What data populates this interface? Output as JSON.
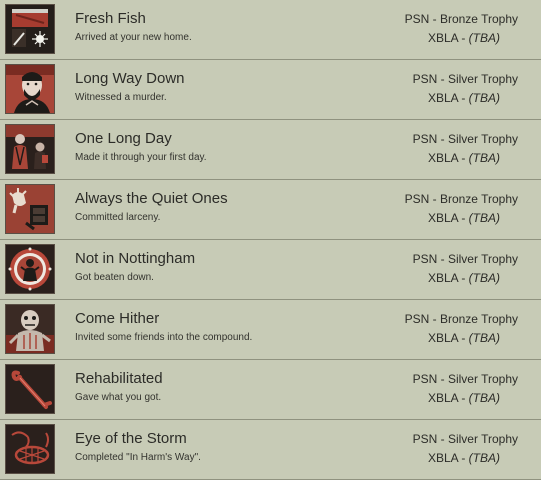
{
  "achievements": [
    {
      "title": "Fresh Fish",
      "description": "Arrived at your new home.",
      "psn": "PSN - Bronze Trophy",
      "xbla_prefix": "XBLA - ",
      "xbla_value": "(TBA)",
      "icon": "crate-spark-icon"
    },
    {
      "title": "Long Way Down",
      "description": "Witnessed a murder.",
      "psn": "PSN - Silver Trophy",
      "xbla_prefix": "XBLA - ",
      "xbla_value": "(TBA)",
      "icon": "bearded-man-portrait-icon"
    },
    {
      "title": "One Long Day",
      "description": "Made it through your first day.",
      "psn": "PSN - Silver Trophy",
      "xbla_prefix": "XBLA - ",
      "xbla_value": "(TBA)",
      "icon": "two-figures-icon"
    },
    {
      "title": "Always the Quiet Ones",
      "description": "Committed larceny.",
      "psn": "PSN - Bronze Trophy",
      "xbla_prefix": "XBLA - ",
      "xbla_value": "(TBA)",
      "icon": "hand-and-box-icon"
    },
    {
      "title": "Not in Nottingham",
      "description": "Got beaten down.",
      "psn": "PSN - Silver Trophy",
      "xbla_prefix": "XBLA - ",
      "xbla_value": "(TBA)",
      "icon": "figure-in-ring-icon"
    },
    {
      "title": "Come Hither",
      "description": "Invited some friends into the compound.",
      "psn": "PSN - Bronze Trophy",
      "xbla_prefix": "XBLA - ",
      "xbla_value": "(TBA)",
      "icon": "zombie-icon"
    },
    {
      "title": "Rehabilitated",
      "description": "Gave what you got.",
      "psn": "PSN - Silver Trophy",
      "xbla_prefix": "XBLA - ",
      "xbla_value": "(TBA)",
      "icon": "crowbar-icon"
    },
    {
      "title": "Eye of the Storm",
      "description": "Completed \"In Harm's Way\".",
      "psn": "PSN - Silver Trophy",
      "xbla_prefix": "XBLA - ",
      "xbla_value": "(TBA)",
      "icon": "rope-net-icon"
    }
  ],
  "colors": {
    "background": "#c7cbb6",
    "divider": "#8f927f",
    "icon_red": "#b8483a",
    "icon_dark": "#1d1b18"
  }
}
